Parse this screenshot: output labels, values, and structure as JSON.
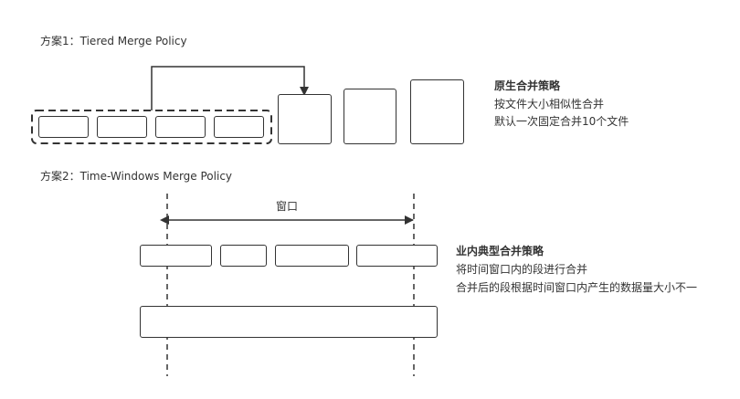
{
  "scheme1": {
    "title": "方案1：Tiered Merge Policy",
    "note_title": "原生合并策略",
    "note_lines": [
      "按文件大小相似性合并",
      "默认一次固定合并10个文件"
    ]
  },
  "scheme2": {
    "title": "方案2：Time-Windows Merge Policy",
    "window_label": "窗口",
    "note_title": "业内典型合并策略",
    "note_lines": [
      "将时间窗口内的段进行合并",
      "合并后的段根据时间窗口内产生的数据量大小不一"
    ]
  },
  "colors": {
    "stroke": "#333333",
    "text": "#333333",
    "background": "#ffffff"
  }
}
